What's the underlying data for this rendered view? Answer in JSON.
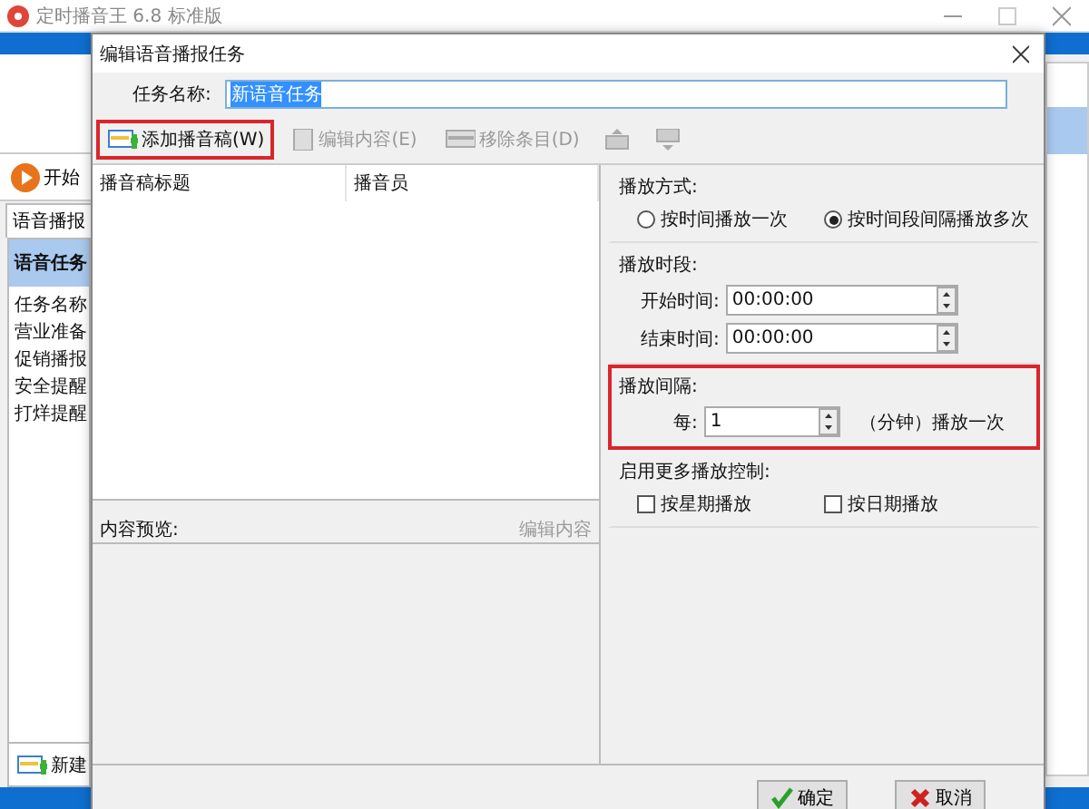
{
  "main_window": {
    "title": "定时播音王 6.8 标准版",
    "toolbar": [
      {
        "label": "开始"
      }
    ],
    "tabs": [
      {
        "label": "语音播报",
        "selected": true
      }
    ],
    "panel_title": "语音任务",
    "list": {
      "header": "任务名称",
      "rows": [
        "营业准备",
        "促销播报",
        "安全提醒",
        "打烊提醒"
      ]
    },
    "bottom_button": "新建"
  },
  "dialog": {
    "title": "编辑语音播报任务",
    "task_name": {
      "label": "任务名称:",
      "value": "新语音任务"
    },
    "toolbar": [
      {
        "kind": "text",
        "label": "添加播音稿(W)",
        "disabled": false,
        "highlighted": true
      },
      {
        "kind": "text",
        "label": "编辑内容(E)",
        "disabled": true,
        "highlighted": false
      },
      {
        "kind": "text",
        "label": "移除条目(D)",
        "disabled": true,
        "highlighted": false
      },
      {
        "kind": "icon",
        "disabled": true,
        "highlighted": false
      },
      {
        "kind": "icon",
        "disabled": true,
        "highlighted": false
      }
    ],
    "table": {
      "columns": [
        "播音稿标题",
        "播音员"
      ]
    },
    "preview": {
      "label": "内容预览:",
      "action": "编辑内容"
    },
    "play_mode": {
      "title": "播放方式:",
      "options": [
        {
          "label": "按时间播放一次",
          "selected": false
        },
        {
          "label": "按时间段间隔播放多次",
          "selected": true
        }
      ]
    },
    "period": {
      "title": "播放时段:",
      "fields": [
        {
          "label": "开始时间:",
          "value": "00:00:00"
        },
        {
          "label": "结束时间:",
          "value": "00:00:00"
        }
      ]
    },
    "interval": {
      "title": "播放间隔:",
      "highlighted": true,
      "label": "每:",
      "value": "1",
      "unit": "（分钟）播放一次"
    },
    "more": {
      "title": "启用更多播放控制:",
      "options": [
        {
          "label": "按星期播放",
          "checked": false
        },
        {
          "label": "按日期播放",
          "checked": false
        }
      ]
    },
    "buttons": [
      {
        "kind": "ok",
        "label": "确定"
      },
      {
        "kind": "cancel",
        "label": "取消"
      }
    ]
  }
}
